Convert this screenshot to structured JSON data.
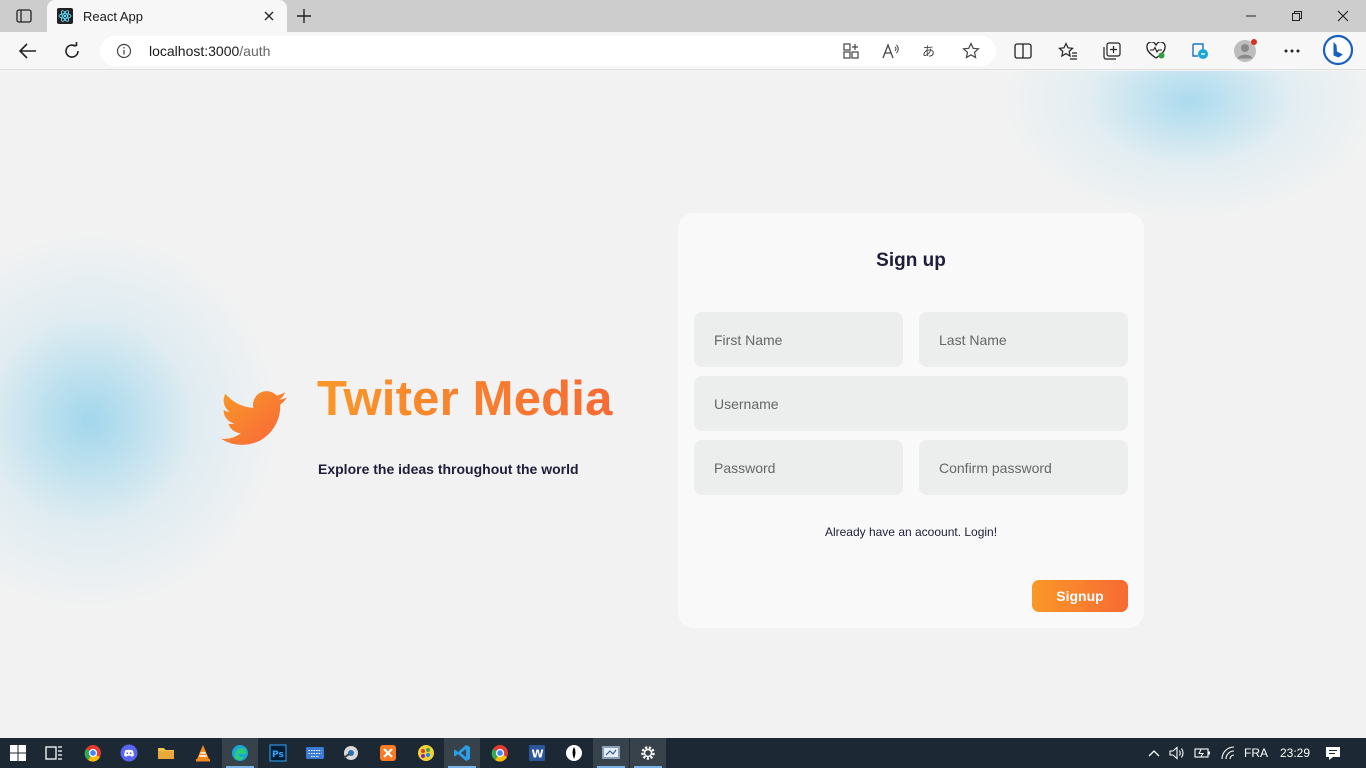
{
  "browser": {
    "tab_title": "React App",
    "address": {
      "host": "localhost:3000",
      "path": "/auth"
    },
    "toolbar_icons": [
      "back-icon",
      "refresh-icon",
      "site-info-icon",
      "app-available-icon",
      "read-aloud-icon",
      "translate-icon",
      "favorite-star-icon",
      "split-screen-icon",
      "favorites-icon",
      "collections-icon",
      "browser-essentials-icon",
      "edge-drop-icon",
      "profile-icon",
      "more-icon",
      "bing-chat-icon"
    ]
  },
  "page": {
    "brand": {
      "title": "Twiter Media",
      "tagline": "Explore the ideas throughout the world"
    },
    "signup_form": {
      "title": "Sign up",
      "fields": {
        "first_name": "First Name",
        "last_name": "Last Name",
        "username": "Username",
        "password": "Password",
        "confirm_password": "Confirm password"
      },
      "login_link": "Already have an acoount. Login!",
      "submit_label": "Signup"
    },
    "colors": {
      "accent_start": "#f99827",
      "accent_end": "#f76a34",
      "text_dark": "#1e1e3a",
      "input_bg": "#eceeee"
    }
  },
  "taskbar": {
    "apps": [
      "task-view",
      "chrome",
      "discord",
      "file-explorer",
      "vlc",
      "edge",
      "photoshop",
      "keyboard",
      "app-settings",
      "xampp",
      "paint-net",
      "vscode",
      "chrome-2",
      "word",
      "inkscape",
      "snipping-tool",
      "settings"
    ],
    "language": "FRA",
    "time": "23:29"
  }
}
